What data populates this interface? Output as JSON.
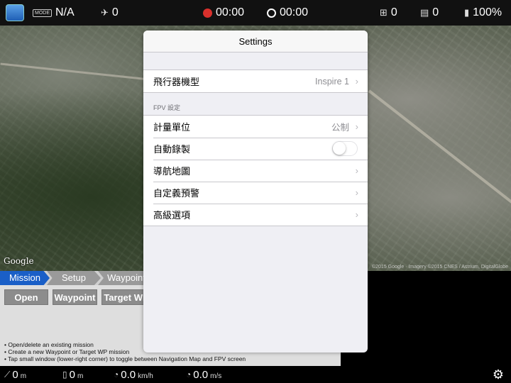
{
  "topbar": {
    "mode_badge": "MODE",
    "flight_mode": "N/A",
    "satellites": "0",
    "record_time": "00:00",
    "flight_time": "00:00",
    "rc_signal": "0",
    "hd_signal": "0",
    "battery": "100%"
  },
  "map": {
    "logo": "Google",
    "attribution": "©2015 Google · Imagery ©2015 CNES / Astrium, DigitalGlobe"
  },
  "mission_tabs": [
    {
      "label": "Mission"
    },
    {
      "label": "Setup"
    },
    {
      "label": "Waypoint"
    }
  ],
  "mission_buttons": {
    "open": "Open",
    "waypoint": "Waypoint",
    "target": "Target WP"
  },
  "help": [
    "• Open/delete an existing mission",
    "• Create a new Waypoint or Target WP mission",
    "• Tap small window (lower-right corner) to toggle between Navigation Map and FPV screen"
  ],
  "bottombar": {
    "distance": "0",
    "distance_unit": "m",
    "height": "0",
    "height_unit": "m",
    "h_speed": "0.0",
    "h_speed_unit": "km/h",
    "v_speed": "0.0",
    "v_speed_unit": "m/s"
  },
  "settings": {
    "title": "Settings",
    "aircraft_label": "飛行器機型",
    "aircraft_value": "Inspire 1",
    "fpv_section": "FPV 設定",
    "units_label": "計量單位",
    "units_value": "公制",
    "autorecord_label": "自動錄製",
    "autorecord_on": false,
    "navmap_label": "導航地圖",
    "custom_alert_label": "自定義預警",
    "advanced_label": "高級選項"
  },
  "colors": {
    "mission_tab": "#1a5fc7",
    "record_dot": "#d9302c"
  }
}
